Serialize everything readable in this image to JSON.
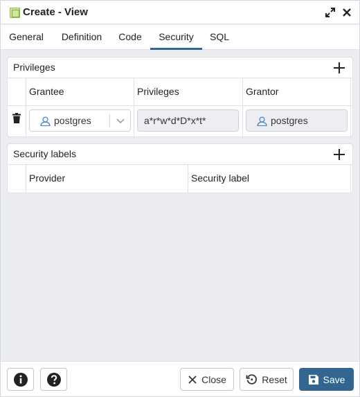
{
  "window": {
    "title": "Create - View"
  },
  "tabs": [
    {
      "label": "General",
      "active": false
    },
    {
      "label": "Definition",
      "active": false
    },
    {
      "label": "Code",
      "active": false
    },
    {
      "label": "Security",
      "active": true
    },
    {
      "label": "SQL",
      "active": false
    }
  ],
  "privileges": {
    "title": "Privileges",
    "columns": [
      "Grantee",
      "Privileges",
      "Grantor"
    ],
    "rows": [
      {
        "grantee": "postgres",
        "privileges": "a*r*w*d*D*x*t*",
        "grantor": "postgres"
      }
    ]
  },
  "security_labels": {
    "title": "Security labels",
    "columns": [
      "Provider",
      "Security label"
    ]
  },
  "footer": {
    "close_label": "Close",
    "reset_label": "Reset",
    "save_label": "Save"
  },
  "colors": {
    "accent": "#326690",
    "background": "#ebedf0"
  }
}
